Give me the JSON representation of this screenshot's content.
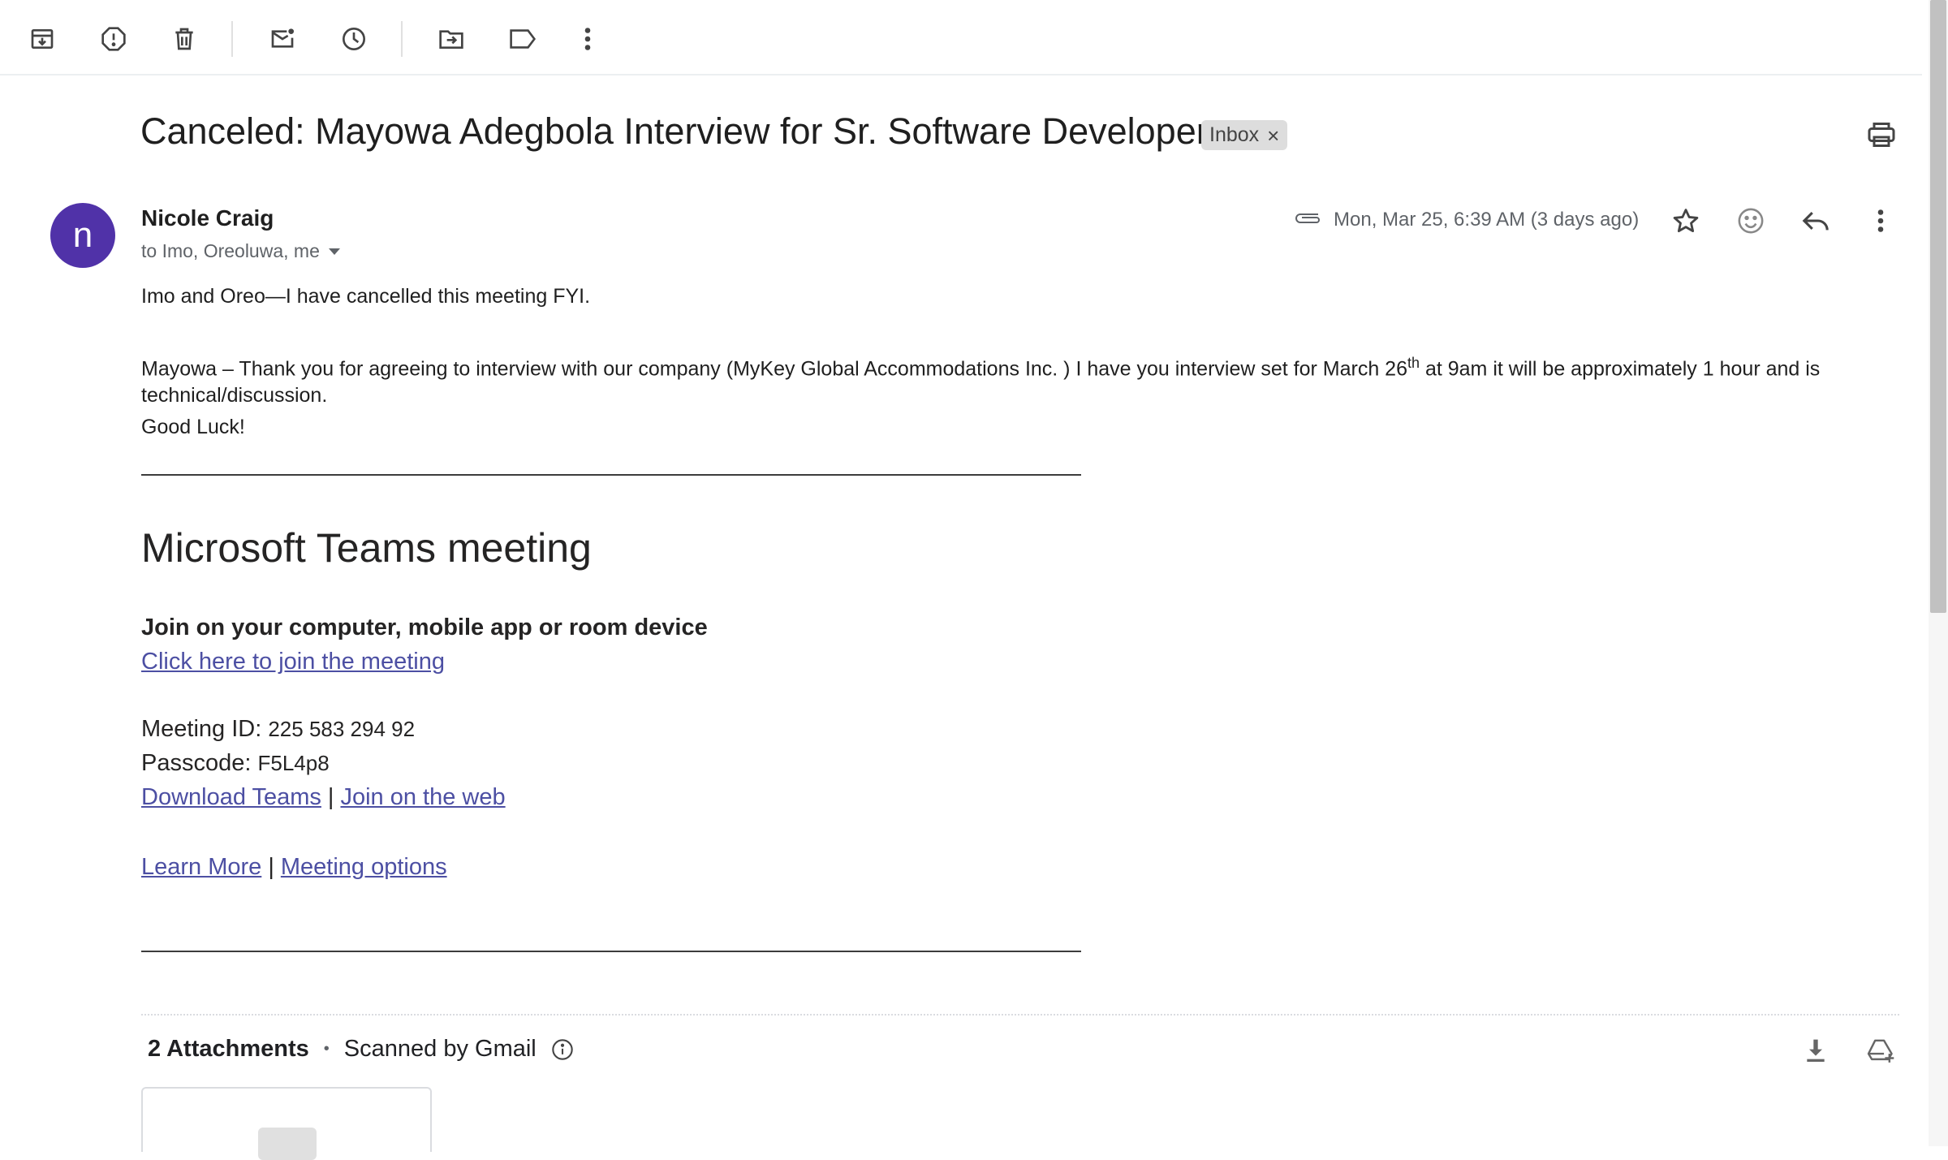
{
  "toolbar": {
    "buttons": [
      {
        "name": "archive",
        "icon": "archive-icon"
      },
      {
        "name": "report-spam",
        "icon": "report-icon"
      },
      {
        "name": "delete",
        "icon": "trash-icon"
      },
      {
        "name": "mark-unread",
        "icon": "mark-unread-icon"
      },
      {
        "name": "snooze",
        "icon": "clock-icon"
      },
      {
        "name": "move-to",
        "icon": "move-to-folder-icon"
      },
      {
        "name": "labels",
        "icon": "label-icon"
      },
      {
        "name": "more",
        "icon": "more-vert-icon"
      }
    ]
  },
  "email": {
    "subject": "Canceled: Mayowa Adegbola Interview for Sr. Software Developer",
    "label_chip": "Inbox",
    "label_chip_close": "×",
    "sender": {
      "name": "Nicole Craig",
      "avatar_letter": "n",
      "avatar_color": "#5032a8"
    },
    "recipients": "to Imo, Oreoluwa, me",
    "date": "Mon, Mar 25, 6:39 AM (3 days ago)",
    "body": {
      "line1": "Imo and Oreo—I have cancelled this meeting FYI.",
      "para2_start": "Mayowa – Thank you for agreeing to interview with our company (MyKey Global Accommodations Inc. ) I have you interview set for March 26",
      "para2_sup": "th",
      "para2_end": " at 9am it will be approximately 1 hour and is",
      "para2_line2": "technical/discussion.",
      "good_luck": "Good Luck!",
      "rule_text": "________________________________________________________________________________"
    },
    "teams": {
      "title": "Microsoft Teams meeting",
      "join_heading": "Join on your computer, mobile app or room device",
      "join_link": "Click here to join the meeting",
      "meeting_id_label": "Meeting ID: ",
      "meeting_id": "225 583 294 92",
      "passcode_label": "Passcode: ",
      "passcode": "F5L4p8",
      "download_link": "Download Teams",
      "web_link": "Join on the web",
      "separator": "|",
      "learn_more": "Learn More",
      "meeting_options": "Meeting options"
    },
    "attachments": {
      "count_label": "2 Attachments",
      "scan_label": "Scanned by Gmail"
    }
  },
  "colors": {
    "link": "#4c4fa3",
    "avatar": "#5032a8",
    "chip_bg": "#dddddd"
  }
}
